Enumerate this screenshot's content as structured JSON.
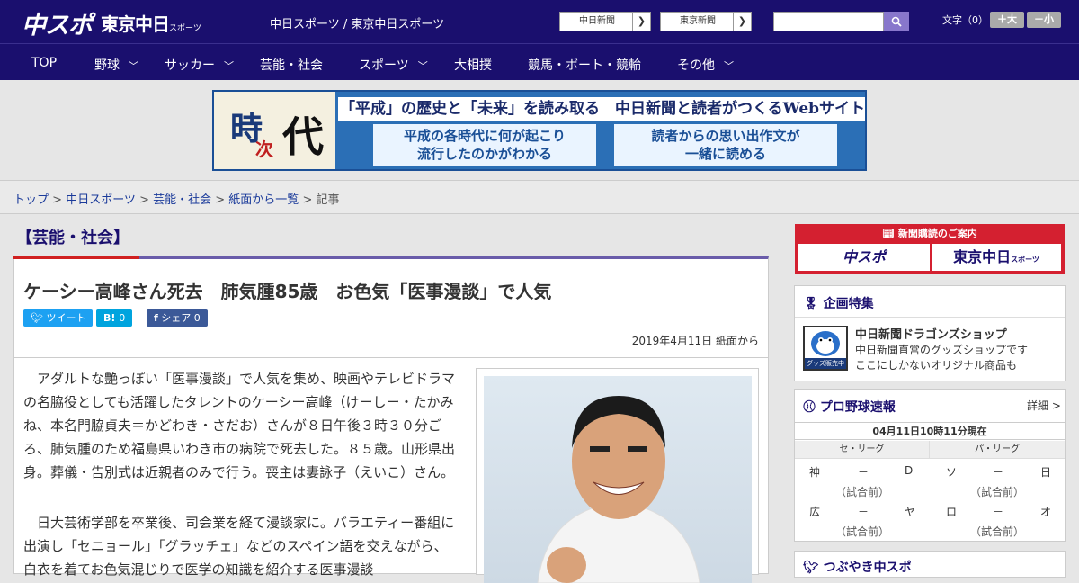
{
  "header": {
    "logo_main": "中スポ",
    "logo_tokyo": "東京中日",
    "logo_tokyo_small": "スポーツ",
    "site_link": "中日スポーツ / 東京中日スポーツ",
    "paper_buttons": [
      {
        "label": "中日新聞"
      },
      {
        "label": "東京新聞"
      }
    ],
    "search_placeholder": "",
    "font_size_label": "文字（0）",
    "font_plus": "＋大",
    "font_minus": "－小"
  },
  "nav": {
    "items": [
      {
        "label": "TOP",
        "dropdown": false
      },
      {
        "label": "野球",
        "dropdown": true
      },
      {
        "label": "サッカー",
        "dropdown": true
      },
      {
        "label": "芸能・社会",
        "dropdown": false
      },
      {
        "label": "スポーツ",
        "dropdown": true
      },
      {
        "label": "大相撲",
        "dropdown": false
      },
      {
        "label": "競馬・ボート・競輪",
        "dropdown": false
      },
      {
        "label": "その他",
        "dropdown": true
      }
    ]
  },
  "banner": {
    "ji": "時",
    "tsugi": "次",
    "dai": "代",
    "headline": "「平成」の歴史と「未来」を読み取る　中日新聞と読者がつくるWebサイト",
    "box1_line1": "平成の各時代に何が起こり",
    "box1_line2": "流行したのかがわかる",
    "box2_line1": "読者からの思い出作文が",
    "box2_line2": "一緒に読める"
  },
  "breadcrumb": {
    "items": [
      "トップ",
      "中日スポーツ",
      "芸能・社会",
      "紙面から一覧"
    ],
    "current": "記事",
    "sep": " > "
  },
  "article": {
    "category": "【芸能・社会】",
    "title": "ケーシー高峰さん死去　肺気腫85歳　お色気「医事漫談」で人気",
    "tweet": "ツイート",
    "hatena": "B!",
    "hatena_count": "0",
    "share": "シェア",
    "share_count": "0",
    "date": "2019年4月11日 紙面から",
    "paragraphs": [
      "アダルトな艶っぽい「医事漫談」で人気を集め、映画やテレビドラマの名脇役としても活躍したタレントのケーシー高峰（けーしー・たかみね、本名門脇貞夫＝かどわき・さだお）さんが８日午後３時３０分ごろ、肺気腫のため福島県いわき市の病院で死去した。８５歳。山形県出身。葬儀・告別式は近親者のみで行う。喪主は妻詠子（えいこ）さん。",
      "日大芸術学部を卒業後、司会業を経て漫談家に。バラエティー番組に出演し「セニョール」「グラッチェ」などのスペイン語を交えながら、白衣を着てお色気混じりで医学の知識を紹介する医事漫談"
    ]
  },
  "sidebar": {
    "subscribe_title": "新聞購読のご案内",
    "subscribe_logo1": "中スポ",
    "subscribe_logo2": "東京中日",
    "subscribe_logo2_small": "スポーツ",
    "feature_title": "企画特集",
    "shop_title": "中日新聞ドラゴンズショップ",
    "shop_desc1": "中日新聞直営のグッズショップです",
    "shop_desc2": "ここにしかないオリジナル商品も",
    "shop_badge": "グッズ販売中",
    "baseball_title": "プロ野球速報",
    "baseball_detail": "詳細 >",
    "baseball_time": "04月11日10時11分現在",
    "central": "セ・リーグ",
    "pacific": "パ・リーグ",
    "games_central": [
      {
        "home": "神",
        "score": "－",
        "away": "D",
        "status": "（試合前）"
      },
      {
        "home": "広",
        "score": "－",
        "away": "ヤ",
        "status": "（試合前）"
      }
    ],
    "games_pacific": [
      {
        "home": "ソ",
        "score": "－",
        "away": "日",
        "status": "（試合前）"
      },
      {
        "home": "ロ",
        "score": "－",
        "away": "オ",
        "status": "（試合前）"
      }
    ],
    "next_title": "つぶやき中スポ"
  }
}
